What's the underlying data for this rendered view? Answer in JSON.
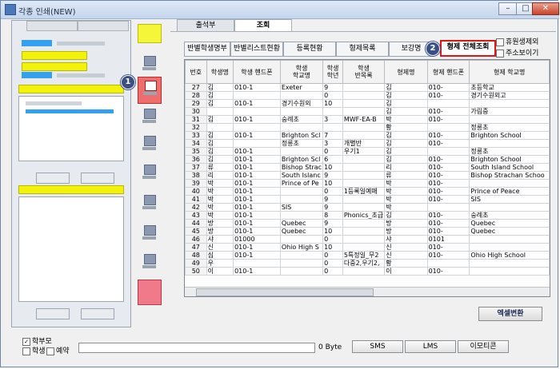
{
  "window": {
    "title": "각종 인쇄(NEW)",
    "min_label": "–",
    "max_label": "□",
    "close_label": "✕"
  },
  "top_tabs": [
    {
      "label": "출석부"
    },
    {
      "label": "조회"
    }
  ],
  "sub_tabs": [
    {
      "label": "반별학생명부"
    },
    {
      "label": "반별리스트현황"
    },
    {
      "label": "등록현황"
    },
    {
      "label": "형제목록"
    },
    {
      "label": "보강명"
    },
    {
      "label": "형제 전체조회"
    }
  ],
  "options": [
    {
      "label": "휴원생제외",
      "checked": false
    },
    {
      "label": "주소보이기",
      "checked": false
    }
  ],
  "callouts": [
    {
      "label": "1"
    },
    {
      "label": "2"
    }
  ],
  "columns": [
    "번호",
    "학생명",
    "학생 핸드폰",
    "학생\n학교명",
    "학생\n학년",
    "학생\n반목록",
    "형제명",
    "형제 핸드폰",
    "형제 학교명"
  ],
  "rows": [
    [
      "27",
      "김",
      "010-1",
      "Exeter",
      "9",
      "",
      "김",
      "010-",
      "초등학교"
    ],
    [
      "28",
      "김",
      "",
      "",
      "0",
      "",
      "김",
      "010-",
      "경기수원외고"
    ],
    [
      "29",
      "김",
      "010-1",
      "경기수원외",
      "10",
      "",
      "김",
      "",
      ""
    ],
    [
      "30",
      "",
      "",
      "",
      "",
      "",
      "김",
      "010-",
      "가림중"
    ],
    [
      "31",
      "김",
      "010-1",
      "숭례초",
      "3",
      "MWF-EA-B",
      "박",
      "010-",
      ""
    ],
    [
      "32",
      "",
      "",
      "",
      "",
      "",
      "황",
      "",
      "정릉초"
    ],
    [
      "33",
      "김",
      "010-1",
      "Brighton Scl",
      "7",
      "",
      "김",
      "010-",
      "Brighton School"
    ],
    [
      "34",
      "김",
      "",
      "정릉초",
      "3",
      "개별반",
      "김",
      "010-",
      ""
    ],
    [
      "35",
      "김",
      "010-1",
      "",
      "0",
      "우기1",
      "김",
      "",
      "정릉초"
    ],
    [
      "36",
      "김",
      "010-1",
      "Brighton Scl",
      "6",
      "",
      "김",
      "010-",
      "Brighton School"
    ],
    [
      "37",
      "류",
      "010-1",
      "Bishop Strac",
      "10",
      "",
      "리",
      "010-",
      "South Island School"
    ],
    [
      "38",
      "리",
      "010-1",
      "South Islanc",
      "9",
      "",
      "류",
      "010-",
      "Bishop Strachan Schoo"
    ],
    [
      "39",
      "박",
      "010-1",
      "Prince of Pe",
      "10",
      "",
      "박",
      "010-",
      ""
    ],
    [
      "40",
      "박",
      "010-1",
      "",
      "0",
      "1등록일예매",
      "박",
      "010-",
      "Prince of Peace"
    ],
    [
      "41",
      "박",
      "010-1",
      "",
      "9",
      "",
      "박",
      "010-",
      "SIS"
    ],
    [
      "42",
      "박",
      "010-1",
      "SIS",
      "9",
      "",
      "박",
      "",
      ""
    ],
    [
      "43",
      "박",
      "010-1",
      "",
      "8",
      "Phonics_초급",
      "김",
      "010-",
      "숭례초"
    ],
    [
      "44",
      "방",
      "010-1",
      "Quebec",
      "9",
      "",
      "방",
      "010-",
      "Quebec"
    ],
    [
      "45",
      "방",
      "010-1",
      "Quebec",
      "10",
      "",
      "방",
      "010-",
      "Quebec"
    ],
    [
      "46",
      "샤",
      "01000",
      "",
      "0",
      "",
      "샤",
      "0101",
      ""
    ],
    [
      "47",
      "신",
      "010-1",
      "Ohio High S",
      "10",
      "",
      "신",
      "010-",
      ""
    ],
    [
      "48",
      "심",
      "010-1",
      "",
      "0",
      "5특정일_무2",
      "신",
      "010-",
      "Ohio High School"
    ],
    [
      "49",
      "우",
      "",
      "",
      "0",
      "다중2,우기2,",
      "황",
      "",
      ""
    ],
    [
      "50",
      "이",
      "010-1",
      "",
      "0",
      "",
      "이",
      "010-",
      ""
    ]
  ],
  "excel_button": "엑셀변환",
  "bottom": {
    "checks": [
      {
        "label": "학부모",
        "checked": true
      },
      {
        "label": "학생",
        "checked": false
      },
      {
        "label": "예약",
        "checked": false
      }
    ],
    "byte_label": "0 Byte",
    "buttons": [
      "SMS",
      "LMS",
      "이모티콘"
    ]
  }
}
